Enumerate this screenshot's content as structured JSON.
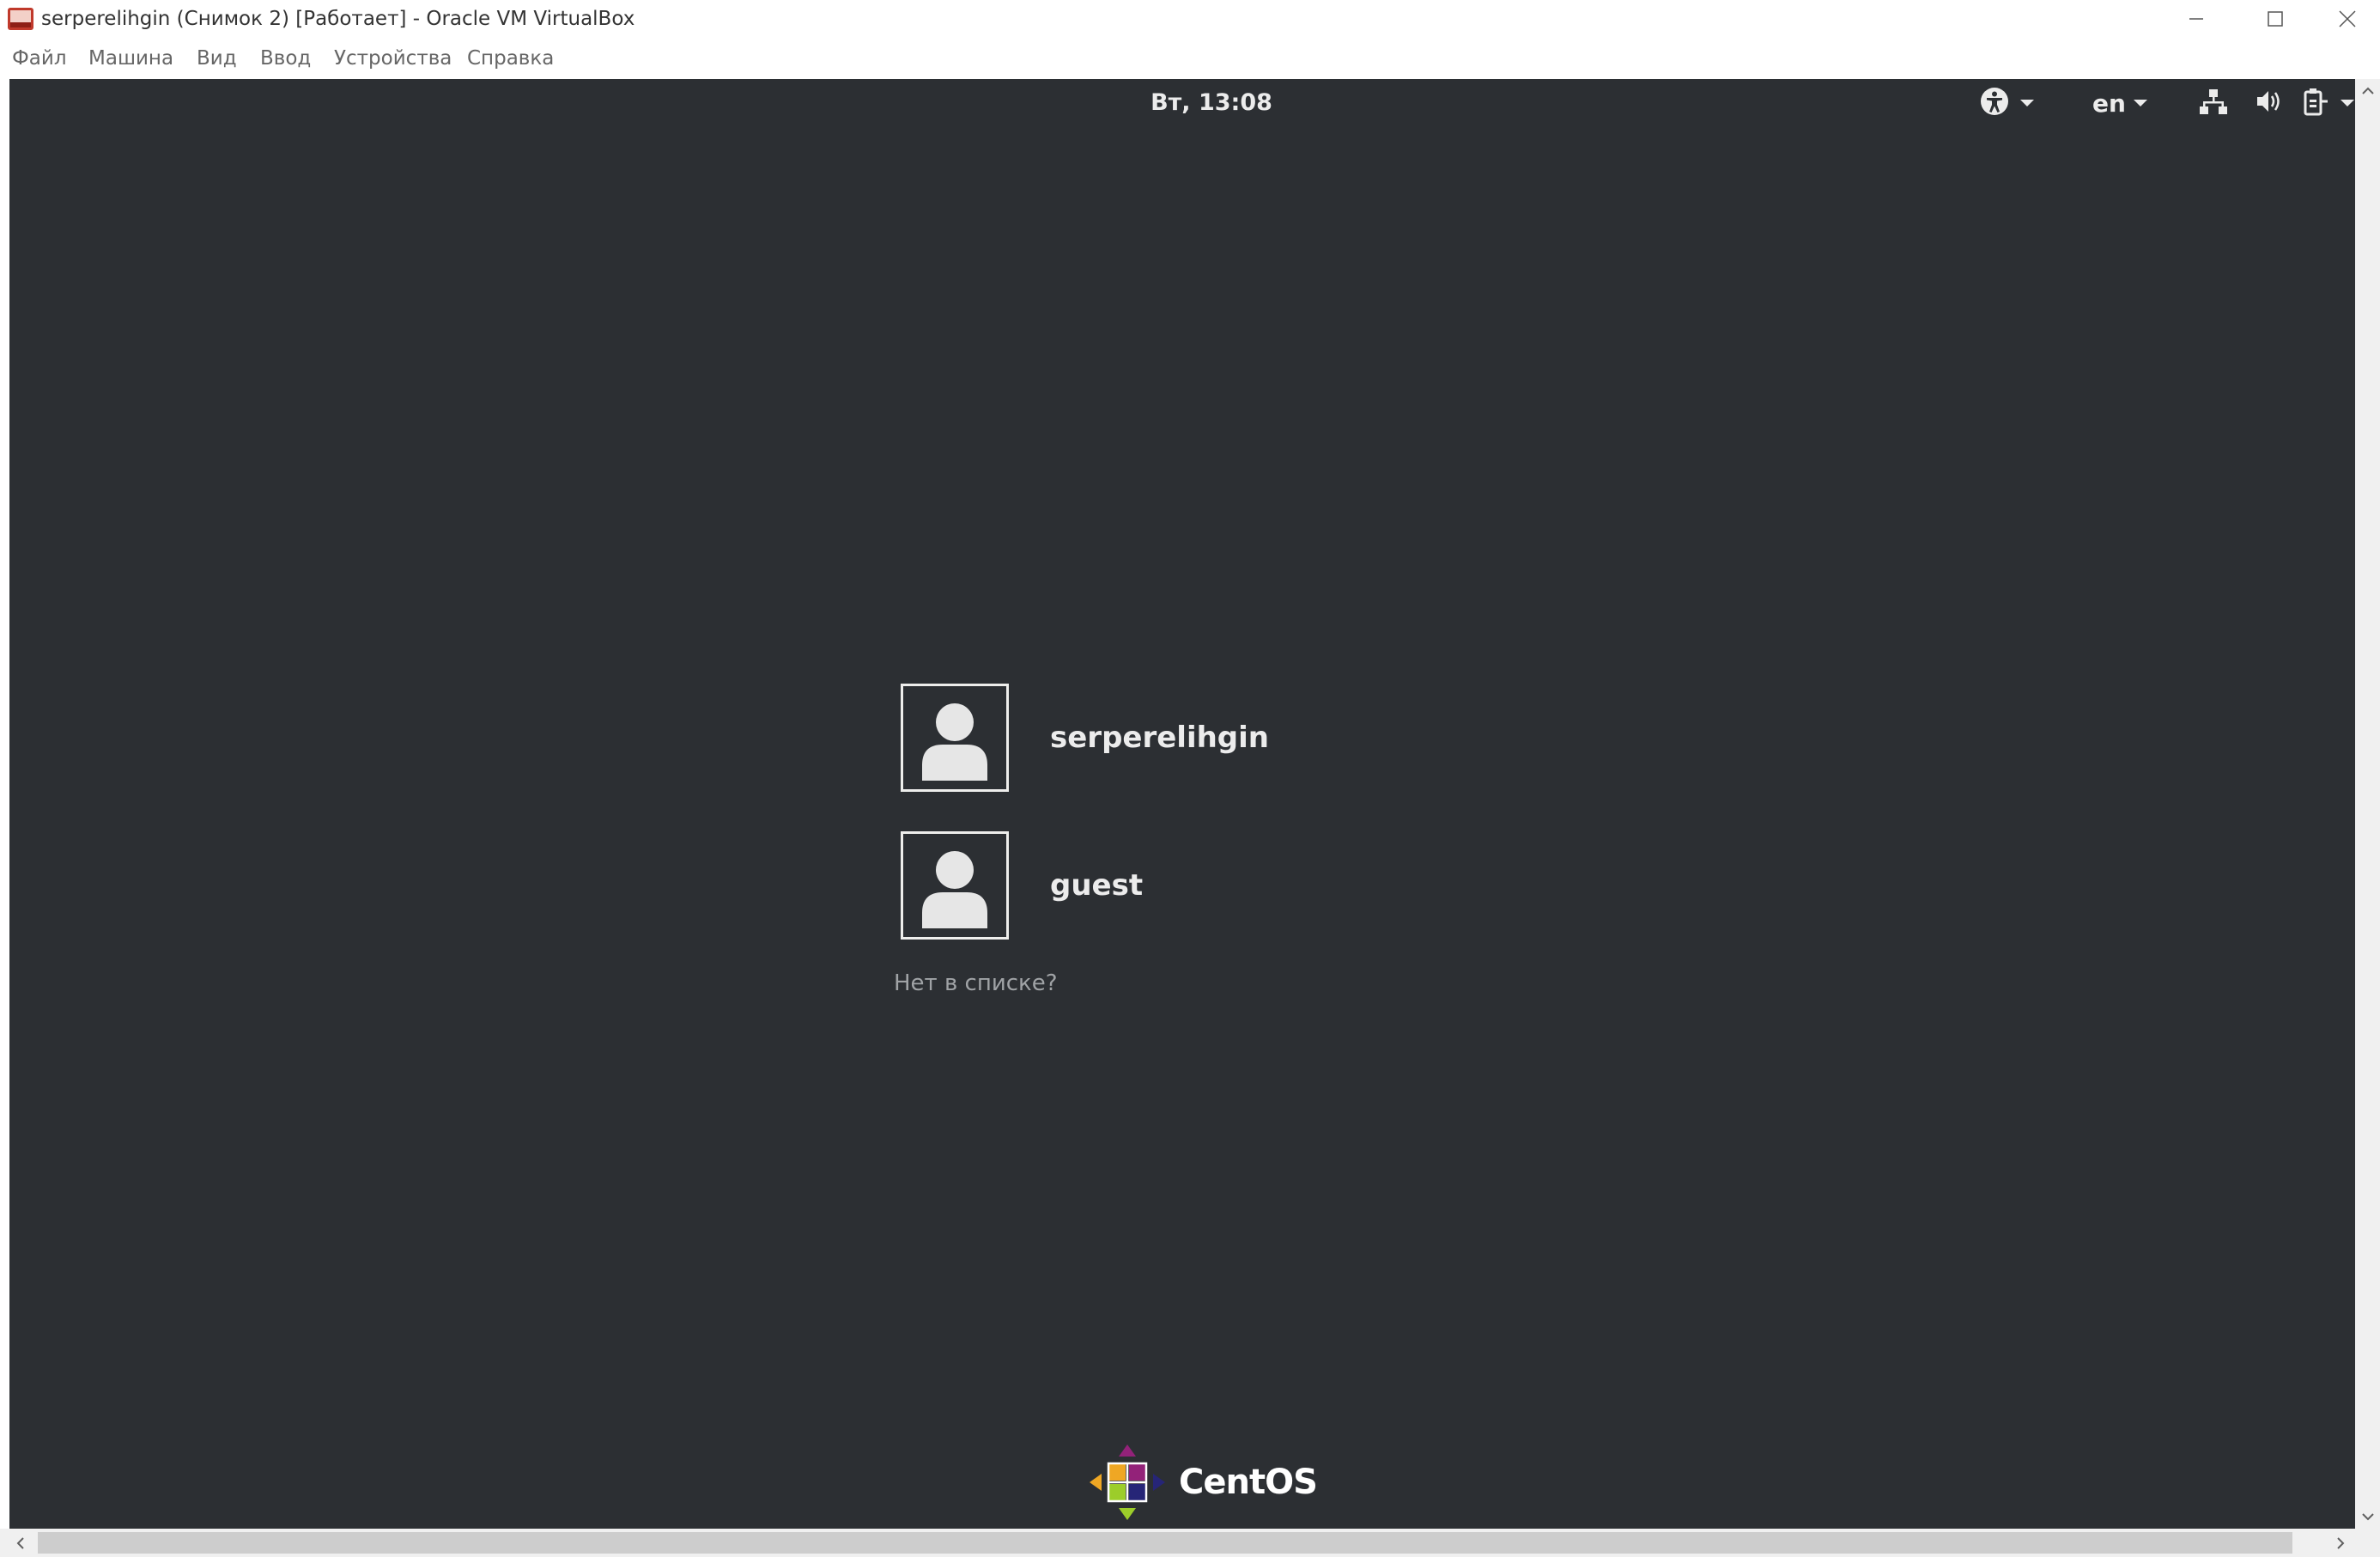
{
  "window": {
    "title": "serperelihgin (Снимок 2) [Работает] - Oracle VM VirtualBox",
    "icon": "virtualbox-app-icon"
  },
  "menubar": {
    "items": [
      "Файл",
      "Машина",
      "Вид",
      "Ввод",
      "Устройства",
      "Справка"
    ]
  },
  "guest": {
    "topbar": {
      "clock": "Вт, 13:08",
      "language": "en",
      "icons": [
        "accessibility-icon",
        "network-icon",
        "volume-icon",
        "power-menu-icon"
      ]
    },
    "users": [
      {
        "name": "serperelihgin"
      },
      {
        "name": "guest"
      }
    ],
    "not_listed": "Нет в списке?",
    "logo_text": "CentOS"
  },
  "colors": {
    "guest_background": "#2c2f33",
    "text_light": "#ececec",
    "centos_purple": "#932279",
    "centos_yellow": "#efa724",
    "centos_green": "#9ccd2a",
    "centos_blue": "#262577"
  }
}
